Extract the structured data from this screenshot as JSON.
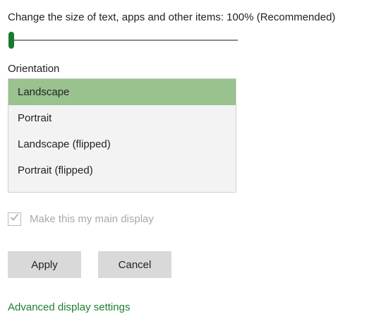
{
  "scale": {
    "label": "Change the size of text, apps and other items: 100% (Recommended)",
    "slider_value_percent": 0
  },
  "orientation": {
    "label": "Orientation",
    "selected": "Landscape",
    "options": [
      "Landscape",
      "Portrait",
      "Landscape (flipped)",
      "Portrait (flipped)"
    ]
  },
  "main_display": {
    "label": "Make this my main display",
    "checked": true,
    "disabled": true
  },
  "buttons": {
    "apply_label": "Apply",
    "cancel_label": "Cancel"
  },
  "links": {
    "advanced_label": "Advanced display settings"
  },
  "colors": {
    "accent": "#177b2f",
    "selected_option": "#99c28f",
    "button_bg": "#d9d9d9",
    "link": "#1f7d30",
    "disabled_text": "#a9a9a9"
  },
  "icons": {
    "checkbox": "checkmark-icon"
  }
}
